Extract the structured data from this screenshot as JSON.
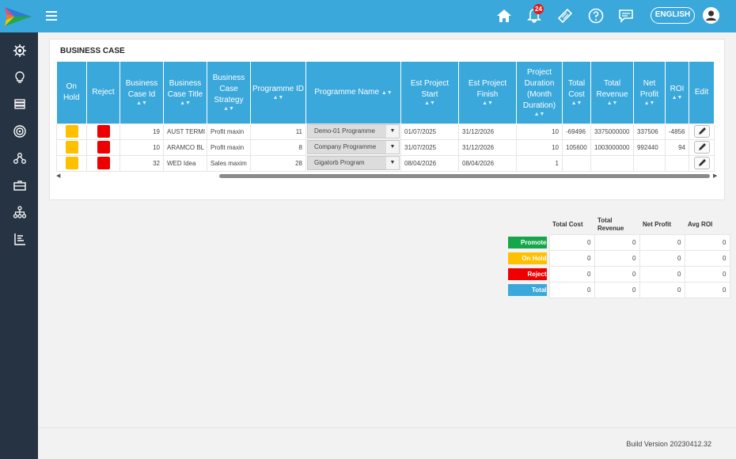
{
  "header": {
    "notification_count": "24",
    "language_label": "ENGLISH",
    "icons": [
      "home-icon",
      "bell-icon",
      "ticket-icon",
      "help-icon",
      "chat-icon",
      "user-icon"
    ]
  },
  "sidebar": {
    "icons": [
      "settings-icon",
      "idea-icon",
      "stack-icon",
      "target-icon",
      "share-icon",
      "briefcase-icon",
      "hierarchy-icon",
      "report-icon"
    ]
  },
  "colors": {
    "brand": "#3aa8db",
    "sidebar": "#263343",
    "hold": "#ffc000",
    "reject": "#ee0000",
    "promote": "#16a64a"
  },
  "business_case": {
    "title": "BUSINESS CASE",
    "columns": {
      "on_hold": "On Hold",
      "reject": "Reject",
      "case_id": "Business Case Id",
      "case_title": "Business Case Title",
      "strategy": "Business Case Strategy",
      "programme_id": "Programme ID",
      "programme_name": "Programme Name",
      "est_start": "Est Project Start",
      "est_finish": "Est Project Finish",
      "duration": "Project Duration (Month Duration)",
      "total_cost": "Total Cost",
      "total_revenue": "Total Revenue",
      "net_profit": "Net Profit",
      "roi": "ROI",
      "edit": "Edit"
    },
    "rows": [
      {
        "case_id": "19",
        "case_title": "AUST TERMI",
        "strategy": "Profit maxin",
        "programme_id": "11",
        "programme_name": "Demo-01 Programme",
        "est_start": "01/07/2025",
        "est_finish": "31/12/2026",
        "duration": "10",
        "total_cost": "-69496",
        "total_revenue": "3375000000",
        "net_profit": "337506",
        "roi": "-4856"
      },
      {
        "case_id": "10",
        "case_title": "ARAMCO BL",
        "strategy": "Profit maxin",
        "programme_id": "8",
        "programme_name": "Company Programme",
        "est_start": "31/07/2025",
        "est_finish": "31/12/2026",
        "duration": "10",
        "total_cost": "105600",
        "total_revenue": "1003000000",
        "net_profit": "992440",
        "roi": "94"
      },
      {
        "case_id": "32",
        "case_title": "WED Idea",
        "strategy": "Sales maxim",
        "programme_id": "28",
        "programme_name": "Gigatorb Program",
        "est_start": "08/04/2026",
        "est_finish": "08/04/2026",
        "duration": "1",
        "total_cost": "",
        "total_revenue": "",
        "net_profit": "",
        "roi": ""
      }
    ]
  },
  "summary": {
    "headers": {
      "total_cost": "Total Cost",
      "total_revenue": "Total Revenue",
      "net_profit": "Net Profit",
      "avg_roi": "Avg ROI"
    },
    "rows": [
      {
        "label": "Promote",
        "total_cost": "0",
        "total_revenue": "0",
        "net_profit": "0",
        "avg_roi": "0"
      },
      {
        "label": "On Hold",
        "total_cost": "0",
        "total_revenue": "0",
        "net_profit": "0",
        "avg_roi": "0"
      },
      {
        "label": "Reject",
        "total_cost": "0",
        "total_revenue": "0",
        "net_profit": "0",
        "avg_roi": "0"
      },
      {
        "label": "Total",
        "total_cost": "0",
        "total_revenue": "0",
        "net_profit": "0",
        "avg_roi": "0"
      }
    ]
  },
  "footer": {
    "build": "Build Version 20230412.32"
  }
}
